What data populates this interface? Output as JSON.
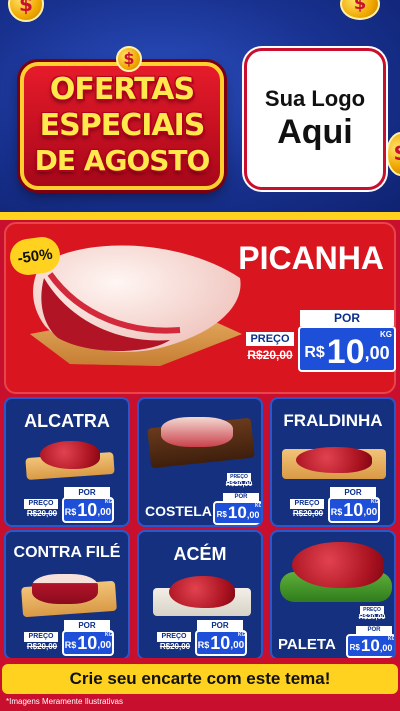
{
  "header": {
    "title_lines": [
      "OFERTAS",
      "ESPECIAIS",
      "DE AGOSTO"
    ],
    "coin_symbol": "$",
    "logo_line1": "Sua Logo",
    "logo_line2": "Aqui"
  },
  "hero": {
    "name": "PICANHA",
    "discount": "-50%",
    "preco_label": "PREÇO",
    "old_price": "R$20,00",
    "por_label": "POR",
    "currency": "R$",
    "new_price_int": "10",
    "new_price_cents": ",00",
    "unit": "KG"
  },
  "products": [
    {
      "name": "ALCATRA",
      "preco_label": "PREÇO",
      "old_price": "R$20,00",
      "por_label": "POR",
      "currency": "R$",
      "price_int": "10",
      "price_cents": ",00",
      "unit": "KG"
    },
    {
      "name": "COSTELA",
      "preco_label": "PREÇO",
      "old_price": "R$20,00",
      "por_label": "POR",
      "currency": "R$",
      "price_int": "10",
      "price_cents": ",00",
      "unit": "KG"
    },
    {
      "name": "FRALDINHA",
      "preco_label": "PREÇO",
      "old_price": "R$20,00",
      "por_label": "POR",
      "currency": "R$",
      "price_int": "10",
      "price_cents": ",00",
      "unit": "KG"
    },
    {
      "name": "CONTRA FILÉ",
      "preco_label": "PREÇO",
      "old_price": "R$20,00",
      "por_label": "POR",
      "currency": "R$",
      "price_int": "10",
      "price_cents": ",00",
      "unit": "KG"
    },
    {
      "name": "ACÉM",
      "preco_label": "PREÇO",
      "old_price": "R$20,00",
      "por_label": "POR",
      "currency": "R$",
      "price_int": "10",
      "price_cents": ",00",
      "unit": "KG"
    },
    {
      "name": "PALETA",
      "preco_label": "PREÇO",
      "old_price": "R$20,00",
      "por_label": "POR",
      "currency": "R$",
      "price_int": "10",
      "price_cents": ",00",
      "unit": "KG"
    }
  ],
  "cta": "Crie seu encarte com este tema!",
  "footnote": "*Imagens Meramente Ilustrativas",
  "colors": {
    "header_blue": "#18318f",
    "brand_red": "#c8102e",
    "accent_yellow": "#ffd21f",
    "price_blue": "#1e4fd8",
    "card_blue": "#14307f"
  }
}
